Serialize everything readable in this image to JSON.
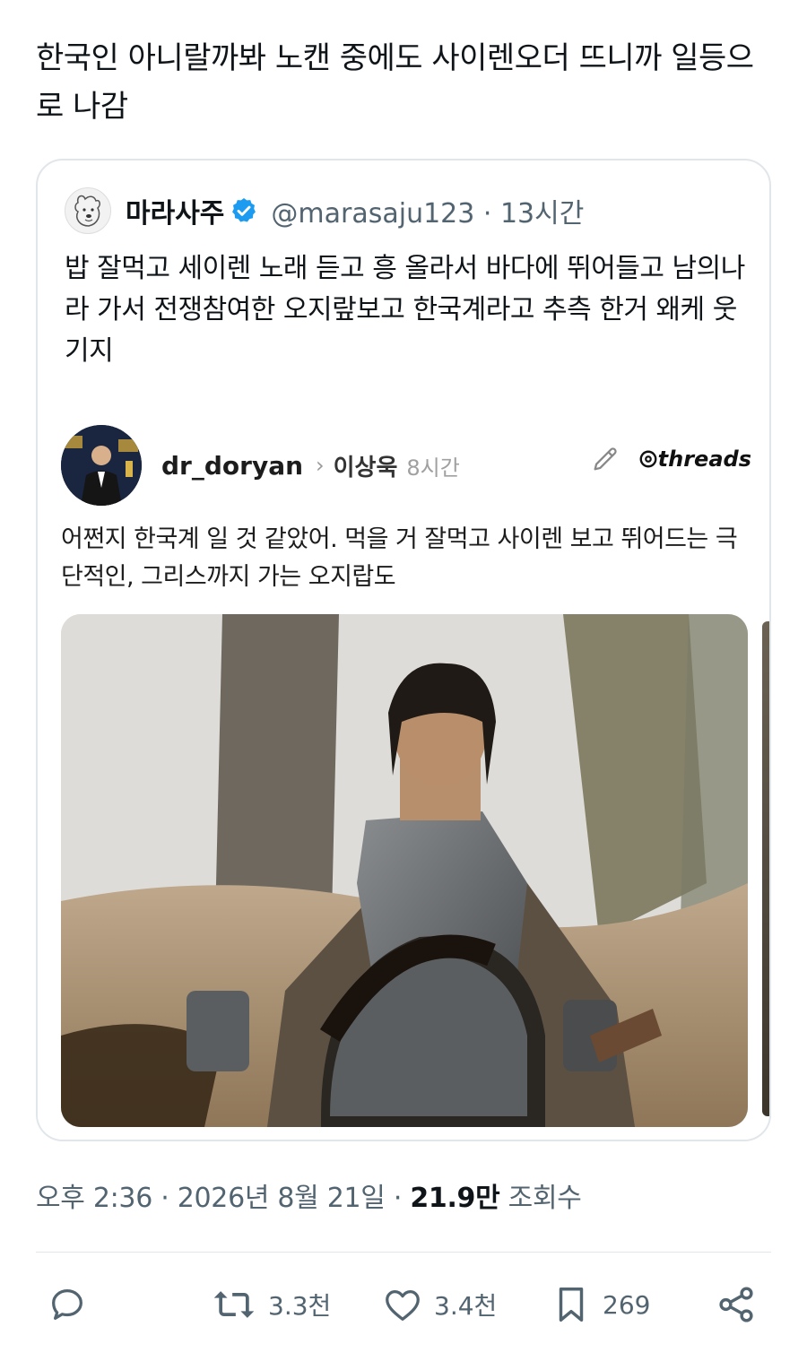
{
  "tweet": {
    "text": "한국인 아니랄까봐 노캔 중에도 사이렌오더 뜨니까 일등으로 나감"
  },
  "quote": {
    "name": "마라사주",
    "handle": "@marasaju123 · 13시간",
    "body": "밥 잘먹고 세이렌 노래 듣고 흥 올라서 바다에 뛰어들고 남의나라 가서 전쟁참여한 오지랖보고 한국계라고 추측 한거 왜케 웃기지"
  },
  "threads": {
    "user": "dr_doryan",
    "arrow": "›",
    "sub_user": "이상욱",
    "time": "8시간",
    "logo": "threads",
    "text": "어쩐지 한국계 일 것 같았어. 먹을 거 잘먹고 사이렌 보고 뛰어드는 극단적인, 그리스까지 가는 오지랍도"
  },
  "meta": {
    "time": "오후 2:36 · 2026년 8월 21일 · ",
    "views": "21.9만",
    "views_label": " 조회수"
  },
  "actions": {
    "reply": "",
    "retweet": "3.3천",
    "like": "3.4천",
    "bookmark": "269"
  },
  "colors": {
    "verified": "#1d9bf0",
    "muted": "#536471",
    "text": "#0f1419",
    "border": "#e1e6ea"
  }
}
